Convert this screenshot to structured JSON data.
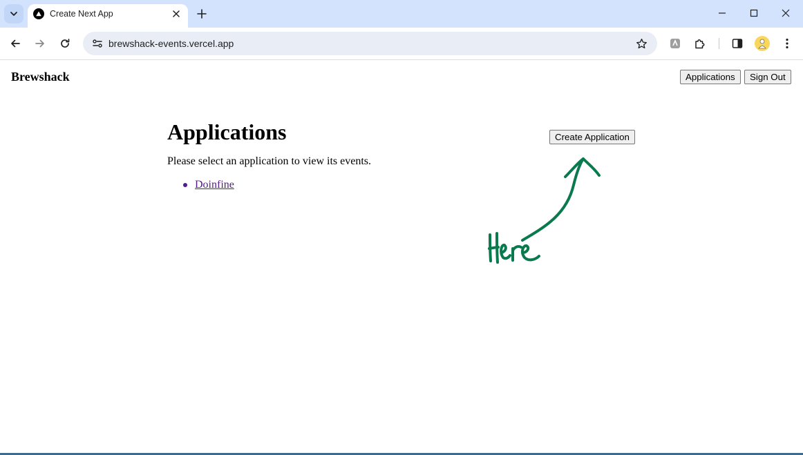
{
  "browser": {
    "tab": {
      "title": "Create Next App",
      "favicon": "triangle-logo-icon"
    },
    "url": "brewshack-events.vercel.app",
    "toolbar_icons": [
      "back-icon",
      "forward-icon",
      "reload-icon",
      "site-info-icon",
      "bookmark-star-icon",
      "extension-icon",
      "puzzle-icon",
      "side-panel-icon",
      "avatar",
      "menu-icon"
    ],
    "window_controls": [
      "minimize-icon",
      "maximize-icon",
      "close-icon"
    ]
  },
  "header": {
    "brand": "Brewshack",
    "applications_label": "Applications",
    "signout_label": "Sign Out"
  },
  "main": {
    "title": "Applications",
    "intro": "Please select an application to view its events.",
    "applications": [
      "Doinfine"
    ],
    "create_label": "Create Application"
  },
  "annotation": {
    "color": "#0a7a4e",
    "icon": "handwritten-arrow-icon"
  },
  "colors": {
    "tabstrip": "#d3e3fd",
    "omnibox": "#e9eef6",
    "visited_link": "#551a8b"
  }
}
